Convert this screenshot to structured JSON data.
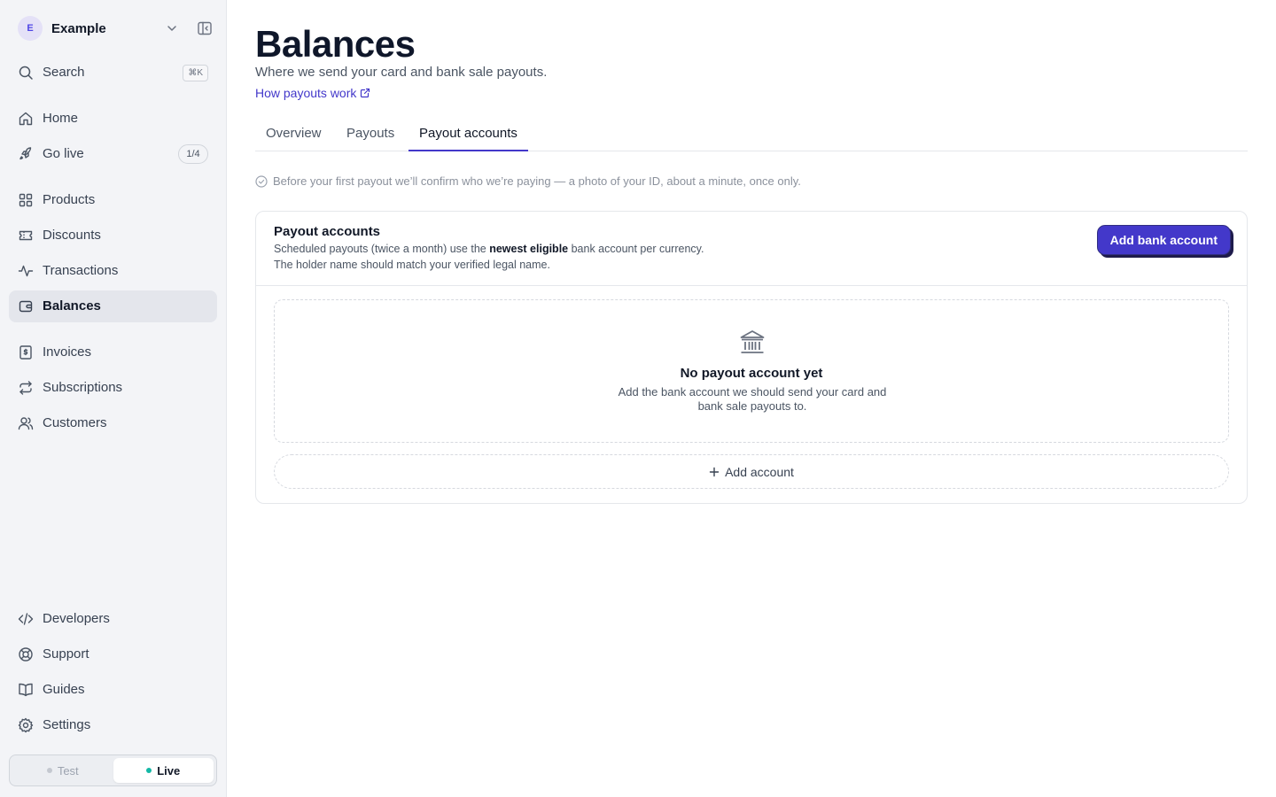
{
  "workspace": {
    "initial": "E",
    "name": "Example"
  },
  "sidebar": {
    "search": {
      "label": "Search",
      "shortcut": "⌘K"
    },
    "items": [
      {
        "id": "home",
        "label": "Home",
        "icon": "home-icon"
      },
      {
        "id": "go-live",
        "label": "Go live",
        "icon": "rocket-icon",
        "badge": "1/4"
      },
      {
        "id": "products",
        "label": "Products",
        "icon": "grid-icon"
      },
      {
        "id": "discounts",
        "label": "Discounts",
        "icon": "ticket-icon"
      },
      {
        "id": "transactions",
        "label": "Transactions",
        "icon": "activity-icon"
      },
      {
        "id": "balances",
        "label": "Balances",
        "icon": "wallet-icon",
        "active": true
      },
      {
        "id": "invoices",
        "label": "Invoices",
        "icon": "receipt-icon"
      },
      {
        "id": "subscriptions",
        "label": "Subscriptions",
        "icon": "repeat-icon"
      },
      {
        "id": "customers",
        "label": "Customers",
        "icon": "users-icon"
      },
      {
        "id": "developers",
        "label": "Developers",
        "icon": "code-icon"
      },
      {
        "id": "support",
        "label": "Support",
        "icon": "lifebuoy-icon"
      },
      {
        "id": "guides",
        "label": "Guides",
        "icon": "book-icon"
      },
      {
        "id": "settings",
        "label": "Settings",
        "icon": "gear-icon"
      }
    ],
    "environment": {
      "test_label": "Test",
      "live_label": "Live",
      "selected": "Live"
    }
  },
  "header": {
    "title": "Balances",
    "subtitle": "Where we send your card and bank sale payouts.",
    "help_link": "How payouts work"
  },
  "tabs": [
    {
      "label": "Overview"
    },
    {
      "label": "Payouts"
    },
    {
      "label": "Payout accounts",
      "active": true
    }
  ],
  "notice": "Before your first payout we’ll confirm who we’re paying — a photo of your ID, about a minute, once only.",
  "payout_card": {
    "title": "Payout accounts",
    "desc_prefix": "Scheduled payouts (twice a month) use the ",
    "desc_bold": "newest eligible",
    "desc_suffix": " bank account per currency.",
    "desc_line2": "The holder name should match your verified legal name.",
    "add_button": "Add bank account",
    "empty_title": "No payout account yet",
    "empty_desc": "Add the bank account we should send your card and bank sale payouts to.",
    "add_row_label": "Add account"
  },
  "colors": {
    "accent": "#4338ca",
    "sidebar_bg": "#f3f4f7",
    "active_item_bg": "#e4e6ec",
    "live_dot": "#14b8a6"
  }
}
